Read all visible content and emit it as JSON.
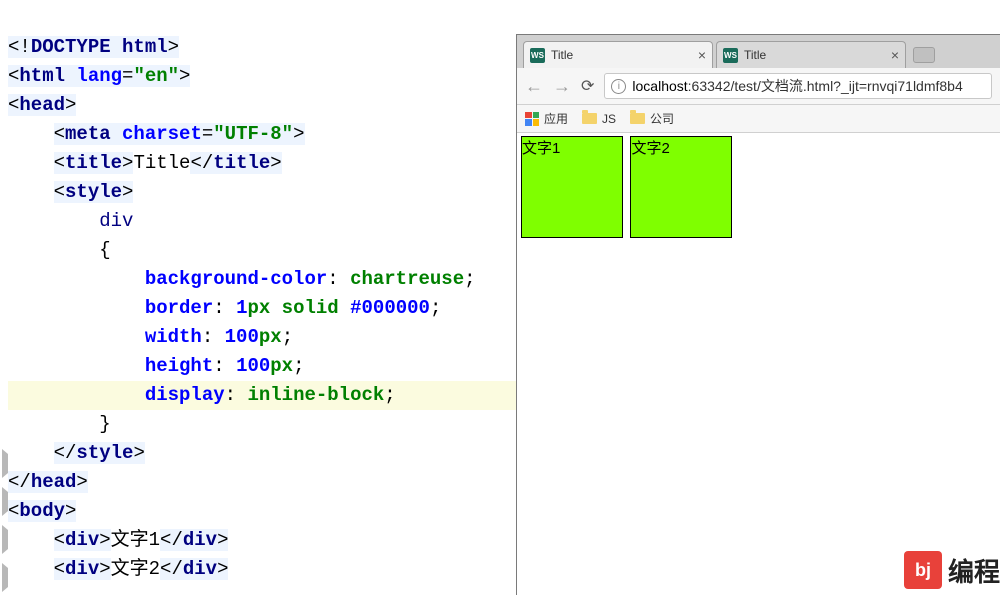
{
  "editor": {
    "lines": {
      "doctype_open": "<!",
      "doctype_tag": "DOCTYPE ",
      "doctype_kw": "html",
      "doctype_close": ">",
      "html_open": "<",
      "html_tag": "html ",
      "html_attr": "lang",
      "html_eq": "=",
      "html_val": "\"en\"",
      "html_close": ">",
      "head_tag": "head",
      "meta_tag": "meta ",
      "meta_attr": "charset",
      "meta_val": "\"UTF-8\"",
      "title_tag": "title",
      "title_text": "Title",
      "style_tag": "style",
      "selector": "div",
      "brace_open": "{",
      "p1_name": "background-color",
      "p1_val": "chartreuse",
      "p2_name": "border",
      "p2_v1": "1",
      "p2_u1": "px",
      "p2_v2": " solid ",
      "p2_v3": "#000000",
      "p3_name": "width",
      "p3_val": "100",
      "p3_unit": "px",
      "p4_name": "height",
      "p4_val": "100",
      "p4_unit": "px",
      "p5_name": "display",
      "p5_val": "inline-block",
      "brace_close": "}",
      "body_tag": "body",
      "div_tag": "div",
      "div1_text": "文字1",
      "div2_text": "文字2"
    }
  },
  "browser": {
    "tabs": [
      {
        "title": "Title"
      },
      {
        "title": "Title"
      }
    ],
    "url_host": "localhost",
    "url_path": ":63342/test/文档流.html?_ijt=rnvqi71ldmf8b4",
    "bookmarks": {
      "apps": "应用",
      "folder1": "JS",
      "folder2": "公司"
    },
    "page": {
      "box1": "文字1",
      "box2": "文字2"
    }
  },
  "watermark": {
    "badge": "bj",
    "text": "编程"
  }
}
